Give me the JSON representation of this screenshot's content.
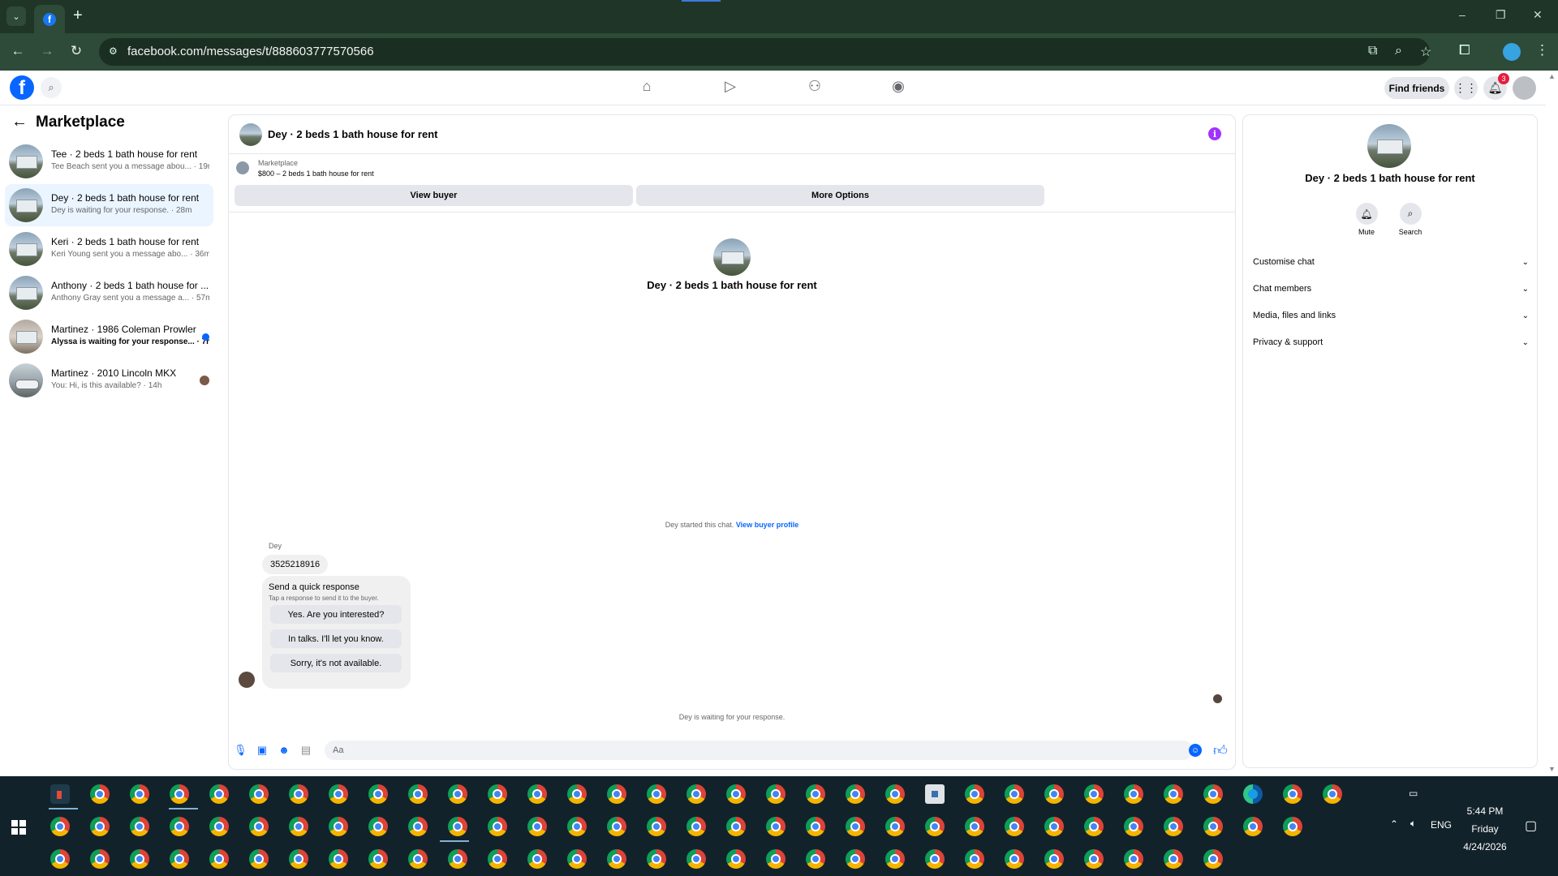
{
  "browser": {
    "url": "facebook.com/messages/t/888603777570566",
    "window_controls": [
      "–",
      "❐",
      "✕"
    ]
  },
  "fb_header": {
    "find_friends": "Find friends",
    "notification_count": "3"
  },
  "sidebar": {
    "title": "Marketplace",
    "conversations": [
      {
        "title": "Tee · 2 beds 1 bath house for rent",
        "subtitle": "Tee Beach sent you a message abou... · 19m",
        "active": false,
        "unread": false,
        "thumb": "house"
      },
      {
        "title": "Dey · 2 beds 1 bath house for rent",
        "subtitle": "Dey is waiting for your response. · 28m",
        "active": true,
        "unread": false,
        "thumb": "house"
      },
      {
        "title": "Keri · 2 beds 1 bath house for rent",
        "subtitle": "Keri Young sent you a message abo... · 36m",
        "active": false,
        "unread": false,
        "thumb": "house"
      },
      {
        "title": "Anthony · 2 beds 1 bath house for ...",
        "subtitle": "Anthony Gray sent you a message a... · 57m",
        "active": false,
        "unread": false,
        "thumb": "house"
      },
      {
        "title": "Martinez · 1986 Coleman Prowler",
        "subtitle": "Alyssa is waiting for your response... · 7h",
        "active": false,
        "unread": true,
        "thumb": "trailer"
      },
      {
        "title": "Martinez · 2010 Lincoln MKX",
        "subtitle": "You: Hi, is this available? · 14h",
        "active": false,
        "unread": false,
        "thumb": "car"
      }
    ]
  },
  "chat": {
    "header_name": "Dey · 2 beds 1 bath house for rent",
    "marketplace_label": "Marketplace",
    "listing": "$800 – 2 beds 1 bath house for rent",
    "view_buyer": "View buyer",
    "more_options": "More Options",
    "center_name": "Dey · 2 beds 1 bath house for rent",
    "started_text": "Dey started this chat.",
    "view_buyer_profile": "View buyer profile",
    "sender_label": "Dey",
    "phone_message": "3525218916",
    "quick_title": "Send a quick response",
    "quick_subtitle": "Tap a response to send it to the buyer.",
    "quick_replies": [
      "Yes. Are you interested?",
      "In talks. I'll let you know.",
      "Sorry, it's not available."
    ],
    "waiting_text": "Dey is waiting for your response.",
    "composer_placeholder": "Aa"
  },
  "details": {
    "name": "Dey · 2 beds 1 bath house for rent",
    "mute": "Mute",
    "search": "Search",
    "sections": [
      "Customise chat",
      "Chat members",
      "Media, files and links",
      "Privacy & support"
    ]
  },
  "taskbar": {
    "time": "5:44 PM",
    "day": "Friday",
    "date": "4/24/2026",
    "language": "ENG"
  },
  "colors": {
    "fb_blue": "#0866ff",
    "chrome_frame": "#1f3527",
    "taskbar": "#12222a",
    "active_conversation": "#ebf5ff"
  }
}
